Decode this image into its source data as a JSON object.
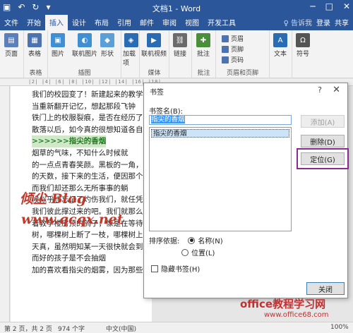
{
  "window": {
    "title": "文档1 - Word",
    "controls": [
      "─",
      "□",
      "✕"
    ]
  },
  "tabs": {
    "items": [
      "文件",
      "开始",
      "插入",
      "设计",
      "布局",
      "引用",
      "邮件",
      "审阅",
      "视图",
      "开发工具"
    ],
    "tell_me": "♀ 告诉我",
    "login": "登录",
    "share": "共享"
  },
  "ribbon": {
    "pages": "页面",
    "table": "表格",
    "picture": "图片",
    "online_picture": "联机图片",
    "shapes": "形状",
    "addins": "加载项",
    "online_video": "联机视频",
    "link": "链接",
    "comment": "批注",
    "header": "页眉",
    "footer": "页脚",
    "page_number": "页码",
    "text": "文本",
    "symbol": "符号",
    "groups": {
      "table": "表格",
      "illustrations": "插图",
      "media": "媒体",
      "comments": "批注",
      "header_footer": "页眉和页脚"
    }
  },
  "ruler": "|2| |4| |6| |8| |10| |12| |14| |16| |18|",
  "document": {
    "lines": [
      "我们的校园变了！新建起来的教学楼高",
      "  当重新翻开记忆，想起那段飞钟",
      "铁门上的校服裂痕，是否在经历了岁",
      "散落以后，如今真的很想知道各自",
      "",
      "  烟草的气味，不知什么时候就",
      "的一点点青春笑颜。黑板的一角，",
      "的天数，接下来的生活，便因那个",
      "  而我们却还那么无所事事的躺",
      "候似乎也忘记了灼伤我们，就任凭",
      "我们彼此撑过来的吧。我们就那么",
      "着教学楼房顶的鸽子，像是在等待",
      "树，哪棵树上断了一枝，哪棵树上",
      "天真，虽然明知某一天很快就会到",
      "        而好的孩子是不会抽烟",
      "加的喜欢看指尖的烟雾，因为那些"
    ],
    "bookmark_heading": ">>>>>>指尖的香烟",
    "watermark_blog": "倾尘 Blog",
    "watermark_url": "www.qcqx.net"
  },
  "dialog": {
    "title": "书签",
    "help": "?",
    "close": "✕",
    "name_label": "书签名(B):",
    "name_value": "指尖的香烟",
    "list_items": [
      "指尖的香烟"
    ],
    "add": "添加(A)",
    "delete": "删除(D)",
    "goto": "定位(G)",
    "sort_label": "排序依据:",
    "sort_name": "名称(N)",
    "sort_location": "位置(L)",
    "hidden_label": "隐藏书签(H)",
    "close_button": "关闭"
  },
  "status": {
    "page": "第 2 页，共 2 页",
    "words": "974 个字",
    "language": "中文(中国)",
    "zoom": "100%"
  },
  "site": {
    "name": "office教程学习网",
    "url": "www.office68.com"
  }
}
